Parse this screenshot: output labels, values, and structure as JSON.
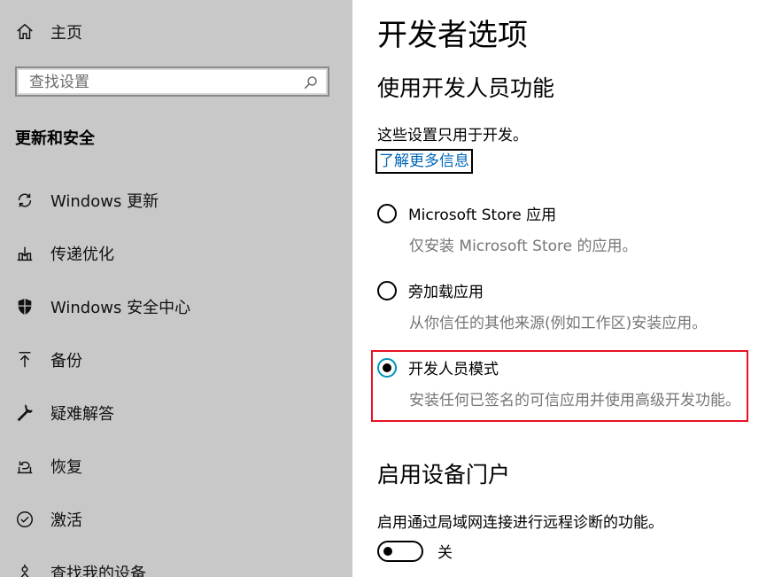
{
  "sidebar": {
    "home": {
      "icon": "home-icon",
      "label": "主页"
    },
    "search": {
      "placeholder": "查找设置",
      "icon": "search-icon"
    },
    "section_title": "更新和安全",
    "items": [
      {
        "icon": "refresh-icon",
        "label": "Windows 更新"
      },
      {
        "icon": "delivery-icon",
        "label": "传递优化"
      },
      {
        "icon": "shield-icon",
        "label": "Windows 安全中心"
      },
      {
        "icon": "backup-arrow-icon",
        "label": "备份"
      },
      {
        "icon": "wrench-icon",
        "label": "疑难解答"
      },
      {
        "icon": "recovery-icon",
        "label": "恢复"
      },
      {
        "icon": "check-circle-icon",
        "label": "激活"
      },
      {
        "icon": "find-device-icon",
        "label": "查找我的设备"
      }
    ]
  },
  "main": {
    "title": "开发者选项",
    "dev_features": {
      "heading": "使用开发人员功能",
      "desc": "这些设置只用于开发。",
      "link": "了解更多信息",
      "options": [
        {
          "label": "Microsoft Store 应用",
          "desc": "仅安装 Microsoft Store 的应用。",
          "selected": false
        },
        {
          "label": "旁加载应用",
          "desc": "从你信任的其他来源(例如工作区)安装应用。",
          "selected": false
        },
        {
          "label": "开发人员模式",
          "desc": "安装任何已签名的可信应用并使用高级开发功能。",
          "selected": true
        }
      ]
    },
    "device_portal": {
      "heading": "启用设备门户",
      "desc": "启用通过局域网连接进行远程诊断的功能。",
      "toggle_state": "关",
      "toggle_on": false
    }
  },
  "colors": {
    "accent": "#0094b8",
    "highlight_border": "#e81123",
    "sidebar_bg": "#c8c8c8",
    "link": "#0067b8"
  }
}
